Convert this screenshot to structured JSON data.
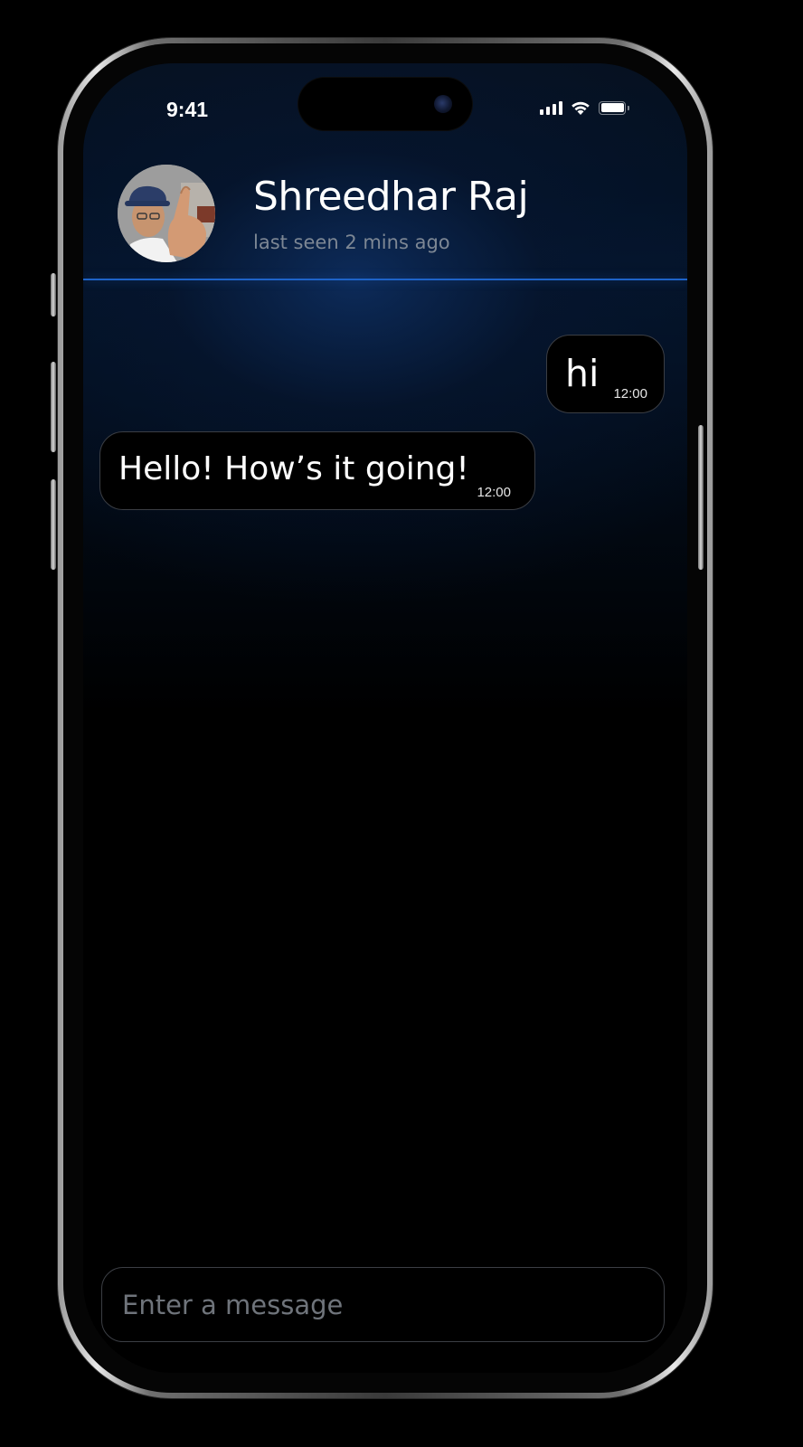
{
  "status_bar": {
    "time": "9:41",
    "icons": [
      "cellular-signal-icon",
      "wifi-icon",
      "battery-icon"
    ]
  },
  "contact": {
    "name": "Shreedhar Raj",
    "status": "last seen 2 mins ago",
    "avatar": "profile-photo"
  },
  "messages": [
    {
      "direction": "outgoing",
      "text": "hi",
      "time": "12:00"
    },
    {
      "direction": "incoming",
      "text": "Hello! How’s it going!",
      "time": "12:00"
    }
  ],
  "composer": {
    "placeholder": "Enter a message",
    "value": ""
  },
  "colors": {
    "background": "#000000",
    "divider": "#1e63c8",
    "bubble_border": "#3b3e44",
    "secondary_text": "#7d8794"
  }
}
